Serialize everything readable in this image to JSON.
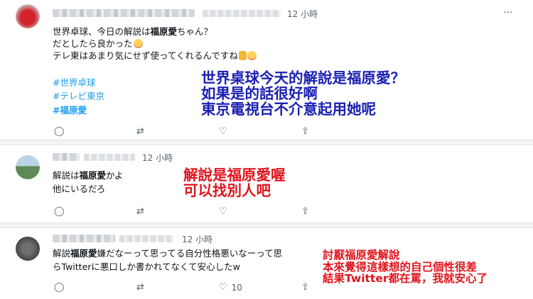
{
  "tweets": [
    {
      "time": "12 小時",
      "text_line1_a": "世界卓球、今日の解説は",
      "text_line1_bold": "福原愛",
      "text_line1_b": "ちゃん？",
      "text_line2": "だとしたら良かった",
      "text_line3": "テレ東はあまり気にせず使ってくれるんですね",
      "hashtags": [
        "#世界卓球",
        "#テレビ東京",
        "#福原愛"
      ],
      "translation": [
        "世界桌球今天的解說是福原愛？",
        "如果是的話很好啊",
        "東京電視台不介意起用她呢"
      ],
      "translation_color": "#1a1fb3",
      "likes": ""
    },
    {
      "time": "12 小時",
      "text_line1_a": "解説は",
      "text_line1_bold": "福原愛",
      "text_line1_b": "かよ",
      "text_line2": "他にいるだろ",
      "translation": [
        "解說是福原愛喔",
        "可以找別人吧"
      ],
      "translation_color": "#e0131c",
      "likes": ""
    },
    {
      "time": "12 小時",
      "text_line1_a": "解説",
      "text_line1_bold": "福原愛",
      "text_line1_b": "嫌だなーって思ってる自分性格悪いなーって思",
      "text_line2": "らTwitterに悪口しか書かれてなくて安心したw",
      "translation": [
        "討厭福原愛解說",
        "本來覺得這樣想的自己個性很差",
        "結果Twitter都在罵，我就安心了"
      ],
      "translation_color": "#e0131c",
      "likes": "10"
    }
  ],
  "icons": [
    "reply-icon",
    "retweet-icon",
    "like-icon",
    "share-icon",
    "more-icon"
  ]
}
